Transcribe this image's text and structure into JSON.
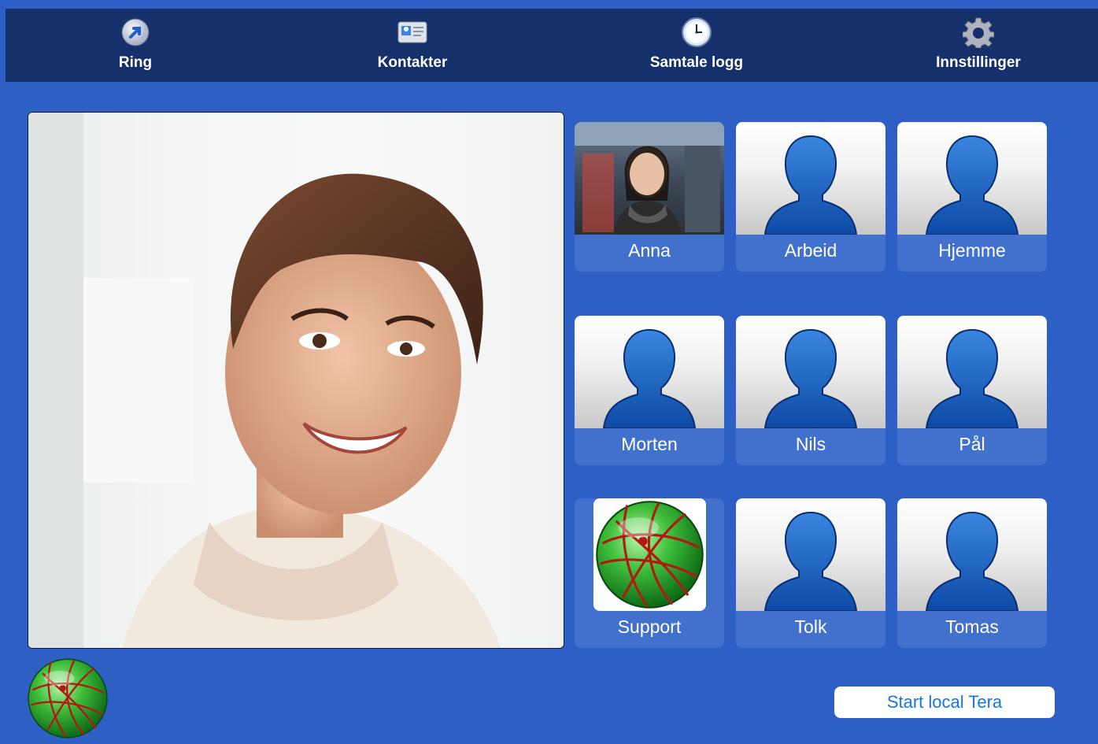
{
  "nav": {
    "tabs": [
      {
        "label": "Ring",
        "icon": "call-arrow-icon"
      },
      {
        "label": "Kontakter",
        "icon": "contacts-card-icon"
      },
      {
        "label": "Samtale logg",
        "icon": "clock-icon"
      },
      {
        "label": "Innstillinger",
        "icon": "gear-icon"
      }
    ]
  },
  "contacts": [
    {
      "name": "Anna",
      "avatar": "photo"
    },
    {
      "name": "Arbeid",
      "avatar": "silhouette"
    },
    {
      "name": "Hjemme",
      "avatar": "silhouette"
    },
    {
      "name": "Morten",
      "avatar": "silhouette"
    },
    {
      "name": "Nils",
      "avatar": "silhouette"
    },
    {
      "name": "Pål",
      "avatar": "silhouette"
    },
    {
      "name": "Support",
      "avatar": "globe-logo"
    },
    {
      "name": "Tolk",
      "avatar": "silhouette"
    },
    {
      "name": "Tomas",
      "avatar": "silhouette"
    }
  ],
  "actions": {
    "start_label": "Start local Tera"
  },
  "colors": {
    "background": "#2d5fc4",
    "topbar": "#15306a",
    "tile": "#4270cd",
    "silhouette": "#1f63c6",
    "button_text": "#1a73e8"
  }
}
